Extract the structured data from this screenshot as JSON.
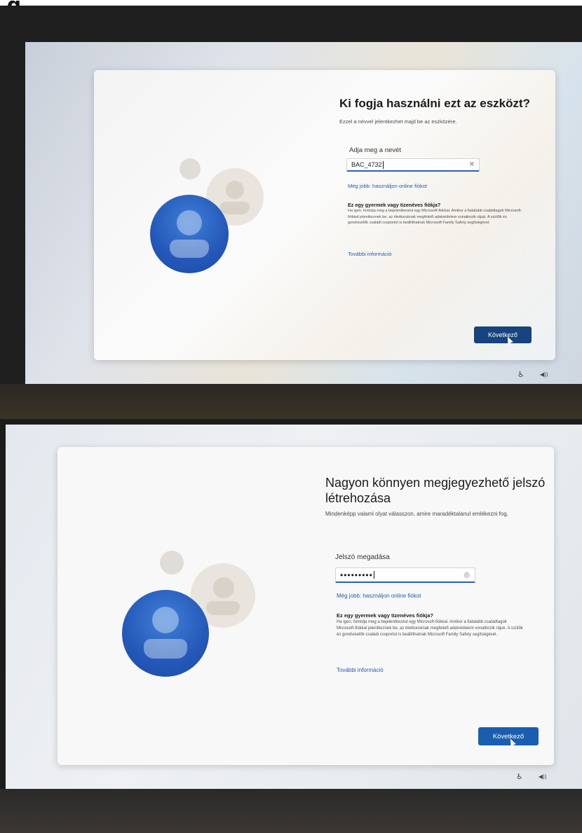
{
  "caption": "g",
  "screen1": {
    "title": "Ki fogja használni ezt az eszközt?",
    "subtitle": "Ezzel a névvel jelentkezhet majd be az eszközére.",
    "field_label": "Adja meg a nevét",
    "input_value": "BAC_4732",
    "clear_icon": "✕",
    "alt_link": "Még jobb: használjon online fiókot",
    "child_heading": "Ez egy gyermek vagy tizenéves fiókja?",
    "child_body": "Ha igen, fontolja meg a bejelentkezést egy Microsoft-fiókkal. Amikor a fiatalabb családtagok Microsoft-fiókkal jelentkeznek be, az életkoruknak megfelelő adatvédelem vonatkozik rájuk. A szülők és gondviselők családi csoportot is beállíthatnak Microsoft Family Safety segítségével.",
    "more_link": "További információ",
    "next_label": "Következő"
  },
  "screen2": {
    "back_icon": "←",
    "title": "Nagyon könnyen megjegyezhető jelszó létrehozása",
    "subtitle": "Mindenképp valami olyat válasszon, amire maradéktalanul emlékezni fog.",
    "field_label": "Jelszó megadása",
    "input_value": "•••••••••",
    "reveal_icon": "◎",
    "alt_link": "Még jobb: használjon online fiókot",
    "child_heading": "Ez egy gyermek vagy tizenéves fiókja?",
    "child_body": "Ha igen, fontolja meg a bejelentkezést egy Microsoft-fiókkal. Amikor a fiatalabb családtagok Microsoft-fiókkal jelentkeznek be, az életkoruknak megfelelő adatvédelem vonatkozik rájuk. A szülők és gondviselők családi csoportot is beállíthatnak Microsoft Family Safety segítségével.",
    "more_link": "További információ",
    "next_label": "Következő"
  },
  "tray": {
    "accessibility_icon": "♿",
    "volume_icon": "◀))"
  }
}
